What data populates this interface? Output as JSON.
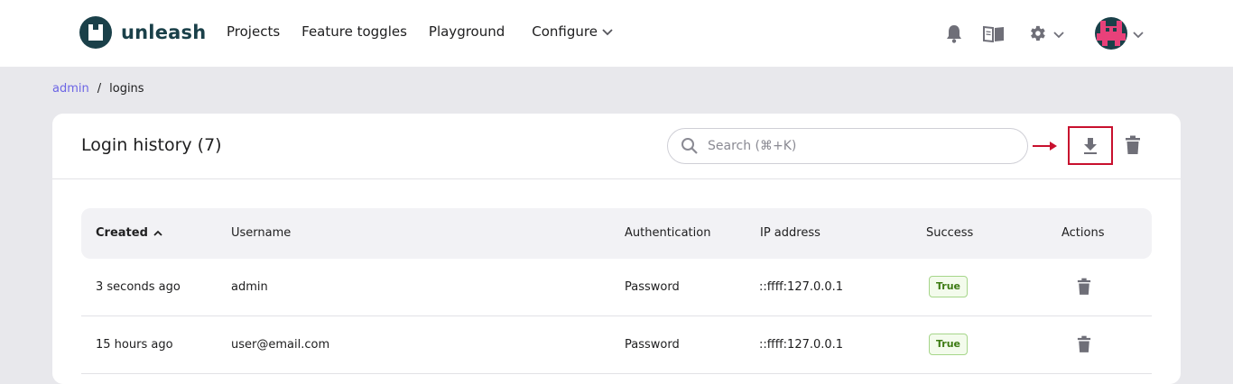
{
  "brand": {
    "name": "unleash"
  },
  "nav": {
    "projects": "Projects",
    "feature_toggles": "Feature toggles",
    "playground": "Playground",
    "configure": "Configure"
  },
  "top_icons": [
    "bell-icon",
    "book-icon",
    "gear-icon",
    "avatar"
  ],
  "breadcrumb": {
    "parent": "admin",
    "separator": "/",
    "current": "logins"
  },
  "page": {
    "title": "Login history (7)",
    "search_placeholder": "Search (⌘+K)"
  },
  "table": {
    "headers": {
      "created": "Created",
      "username": "Username",
      "authentication": "Authentication",
      "ip": "IP address",
      "success": "Success",
      "actions": "Actions"
    },
    "rows": [
      {
        "created": "3 seconds ago",
        "username": "admin",
        "authentication": "Password",
        "ip": "::ffff:127.0.0.1",
        "success": "True"
      },
      {
        "created": "15 hours ago",
        "username": "user@email.com",
        "authentication": "Password",
        "ip": "::ffff:127.0.0.1",
        "success": "True"
      }
    ]
  },
  "colors": {
    "brand": "#1a4049",
    "link": "#6c65e5",
    "highlight": "#c8102e",
    "success": "#3c7a12"
  }
}
